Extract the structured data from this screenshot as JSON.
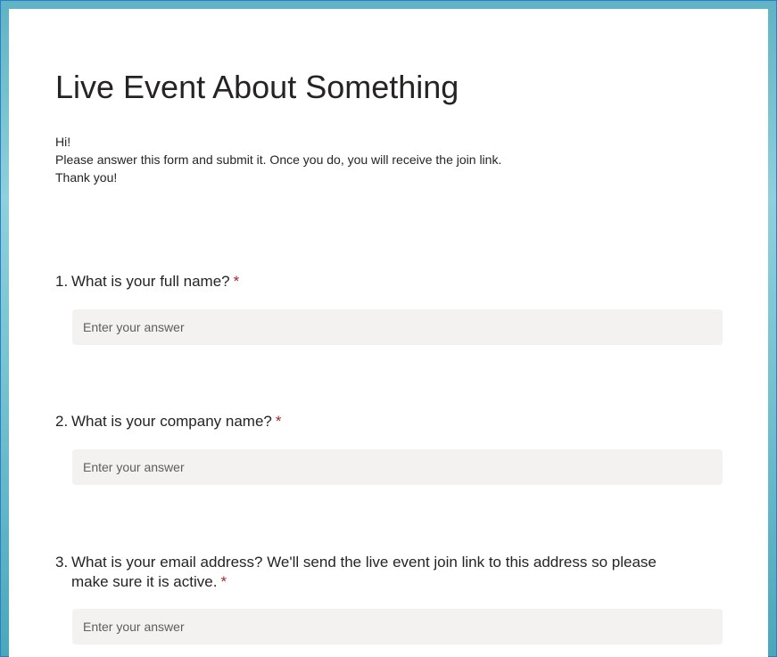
{
  "form": {
    "title": "Live Event About Something",
    "description": [
      "Hi!",
      "Please answer this form and submit it. Once you do, you will receive the join link.",
      "Thank you!"
    ],
    "required_mark": "*",
    "questions": [
      {
        "number": "1.",
        "text": "What is your full name?",
        "placeholder": "Enter your answer"
      },
      {
        "number": "2.",
        "text": "What is your company name?",
        "placeholder": "Enter your answer"
      },
      {
        "number": "3.",
        "text": "What is your email address? We'll send the live event join link to this address so please make sure it is active.",
        "placeholder": "Enter your answer"
      }
    ]
  },
  "colors": {
    "required": "#a4262c",
    "input_background": "#f3f2f1",
    "text": "#252423"
  }
}
